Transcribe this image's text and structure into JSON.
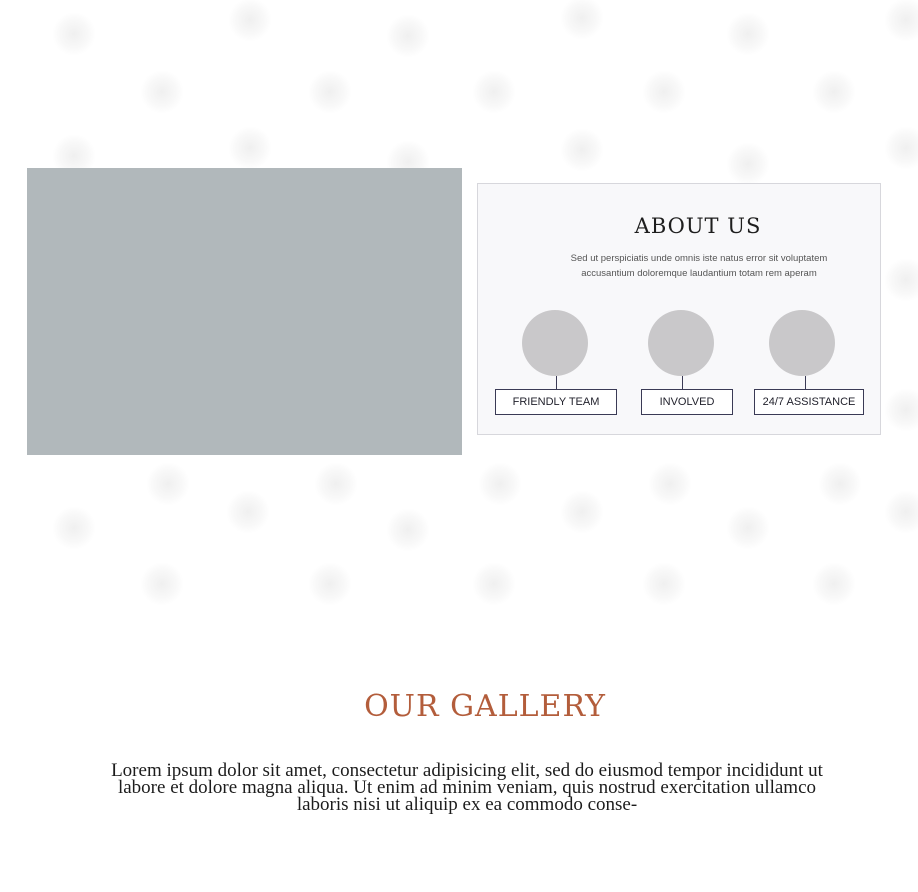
{
  "about": {
    "title": "ABOUT US",
    "text": "Sed ut perspiciatis unde omnis iste natus error sit voluptatem accusantium doloremque laudantium totam rem aperam",
    "features": [
      {
        "label": "FRIENDLY TEAM",
        "icon": "placeholder-circle"
      },
      {
        "label": "INVOLVED",
        "icon": "placeholder-circle"
      },
      {
        "label": "24/7 ASSISTANCE",
        "icon": "placeholder-circle"
      }
    ]
  },
  "gallery": {
    "title": "OUR GALLERY",
    "text": "Lorem ipsum dolor sit amet, consectetur adipisicing elit, sed do eiusmod tempor incididunt ut labore et dolore magna aliqua. Ut enim ad minim veniam, quis nostrud exercitation ullamco laboris nisi ut aliquip ex ea commodo conse-"
  },
  "colors": {
    "accent": "#b35d3b",
    "image_placeholder": "#b1b8bb",
    "circle_placeholder": "#c9c8ca",
    "box_border": "#3a3a55"
  }
}
